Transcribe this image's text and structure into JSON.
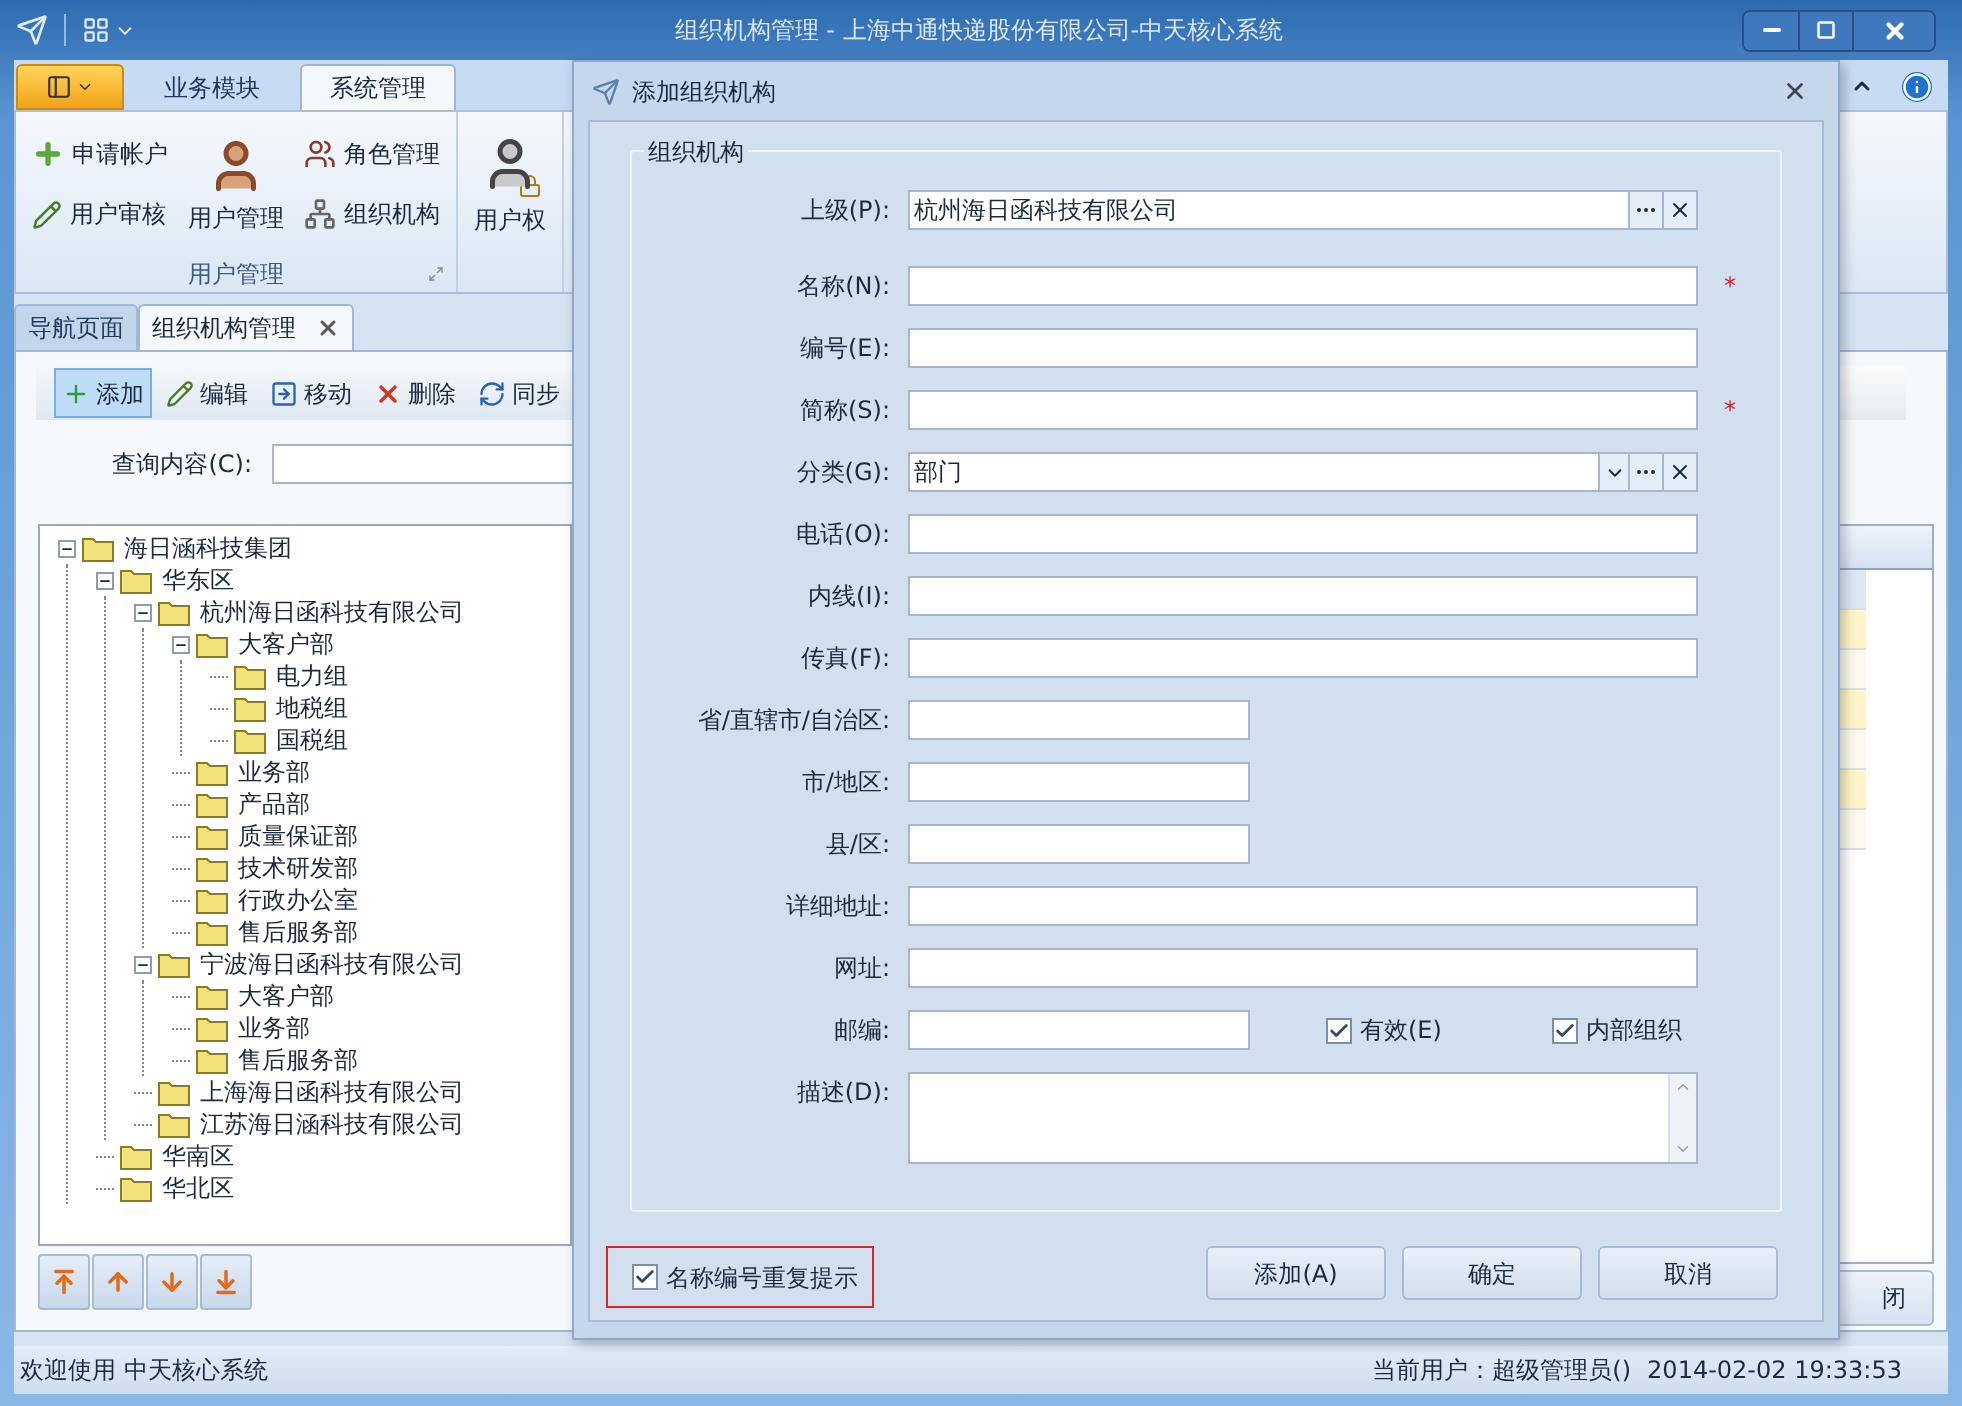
{
  "window": {
    "title": "组织机构管理 - 上海中通快递股份有限公司-中天核心系统"
  },
  "ribbon": {
    "tabs": [
      {
        "label": "业务模块",
        "selected": false
      },
      {
        "label": "系统管理",
        "selected": true
      }
    ],
    "groups": [
      {
        "label": "用户管理",
        "items": [
          {
            "label": "申请帐户",
            "kind": "small"
          },
          {
            "label": "用户审核",
            "kind": "small"
          },
          {
            "label": "用户管理",
            "kind": "large"
          },
          {
            "label": "角色管理",
            "kind": "small"
          },
          {
            "label": "组织机构",
            "kind": "small"
          }
        ]
      },
      {
        "items": [
          {
            "label": "用户权",
            "kind": "large"
          }
        ]
      }
    ]
  },
  "doc_tabs": [
    {
      "label": "导航页面",
      "selected": false,
      "closable": false
    },
    {
      "label": "组织机构管理",
      "selected": true,
      "closable": true
    }
  ],
  "toolbar": [
    {
      "label": "添加",
      "selected": true
    },
    {
      "label": "编辑",
      "selected": false
    },
    {
      "label": "移动",
      "selected": false
    },
    {
      "label": "删除",
      "selected": false
    },
    {
      "label": "同步",
      "selected": false
    }
  ],
  "search": {
    "label": "查询内容(C):"
  },
  "tree": [
    {
      "label": "海日涵科技集团",
      "expanded": true,
      "children": [
        {
          "label": "华东区",
          "expanded": true,
          "children": [
            {
              "label": "杭州海日函科技有限公司",
              "expanded": true,
              "children": [
                {
                  "label": "大客户部",
                  "expanded": true,
                  "children": [
                    {
                      "label": "电力组"
                    },
                    {
                      "label": "地税组"
                    },
                    {
                      "label": "国税组"
                    }
                  ]
                },
                {
                  "label": "业务部"
                },
                {
                  "label": "产品部"
                },
                {
                  "label": "质量保证部"
                },
                {
                  "label": "技术研发部"
                },
                {
                  "label": "行政办公室"
                },
                {
                  "label": "售后服务部"
                }
              ]
            },
            {
              "label": "宁波海日函科技有限公司",
              "expanded": true,
              "children": [
                {
                  "label": "大客户部"
                },
                {
                  "label": "业务部"
                },
                {
                  "label": "售后服务部"
                }
              ]
            },
            {
              "label": "上海海日函科技有限公司"
            },
            {
              "label": "江苏海日涵科技有限公司"
            }
          ]
        },
        {
          "label": "华南区"
        },
        {
          "label": "华北区"
        }
      ]
    }
  ],
  "right_panel": {
    "close_button": "闭"
  },
  "status_bar": {
    "welcome": "欢迎使用 中天核心系统",
    "user": "当前用户：超级管理员()",
    "time": "2014-02-02 19:33:53"
  },
  "dialog": {
    "title": "添加组织机构",
    "group_title": "组织机构",
    "fields": [
      {
        "label": "上级(P):",
        "kind": "lookup",
        "value": "杭州海日函科技有限公司",
        "required": false
      },
      {
        "label": "名称(N):",
        "kind": "text",
        "required": true
      },
      {
        "label": "编号(E):",
        "kind": "text",
        "required": false
      },
      {
        "label": "简称(S):",
        "kind": "text",
        "required": true
      },
      {
        "label": "分类(G):",
        "kind": "combo",
        "value": "部门",
        "required": false
      },
      {
        "label": "电话(O):",
        "kind": "text",
        "required": false
      },
      {
        "label": "内线(I):",
        "kind": "text",
        "required": false
      },
      {
        "label": "传真(F):",
        "kind": "text",
        "required": false
      },
      {
        "label": "省/直辖市/自治区:",
        "kind": "short",
        "required": false
      },
      {
        "label": "市/地区:",
        "kind": "short",
        "required": false
      },
      {
        "label": "县/区:",
        "kind": "short",
        "required": false
      },
      {
        "label": "详细地址:",
        "kind": "text",
        "required": false
      },
      {
        "label": "网址:",
        "kind": "text",
        "required": false
      },
      {
        "label": "邮编:",
        "kind": "short",
        "required": false,
        "checks": [
          {
            "label": "有效(E)",
            "checked": true
          },
          {
            "label": "内部组织",
            "checked": true
          }
        ]
      },
      {
        "label": "描述(D):",
        "kind": "memo",
        "required": false
      }
    ],
    "required_mark": "*",
    "footer_check": {
      "label": "名称编号重复提示",
      "checked": true
    },
    "buttons": [
      "添加(A)",
      "确定",
      "取消"
    ]
  }
}
